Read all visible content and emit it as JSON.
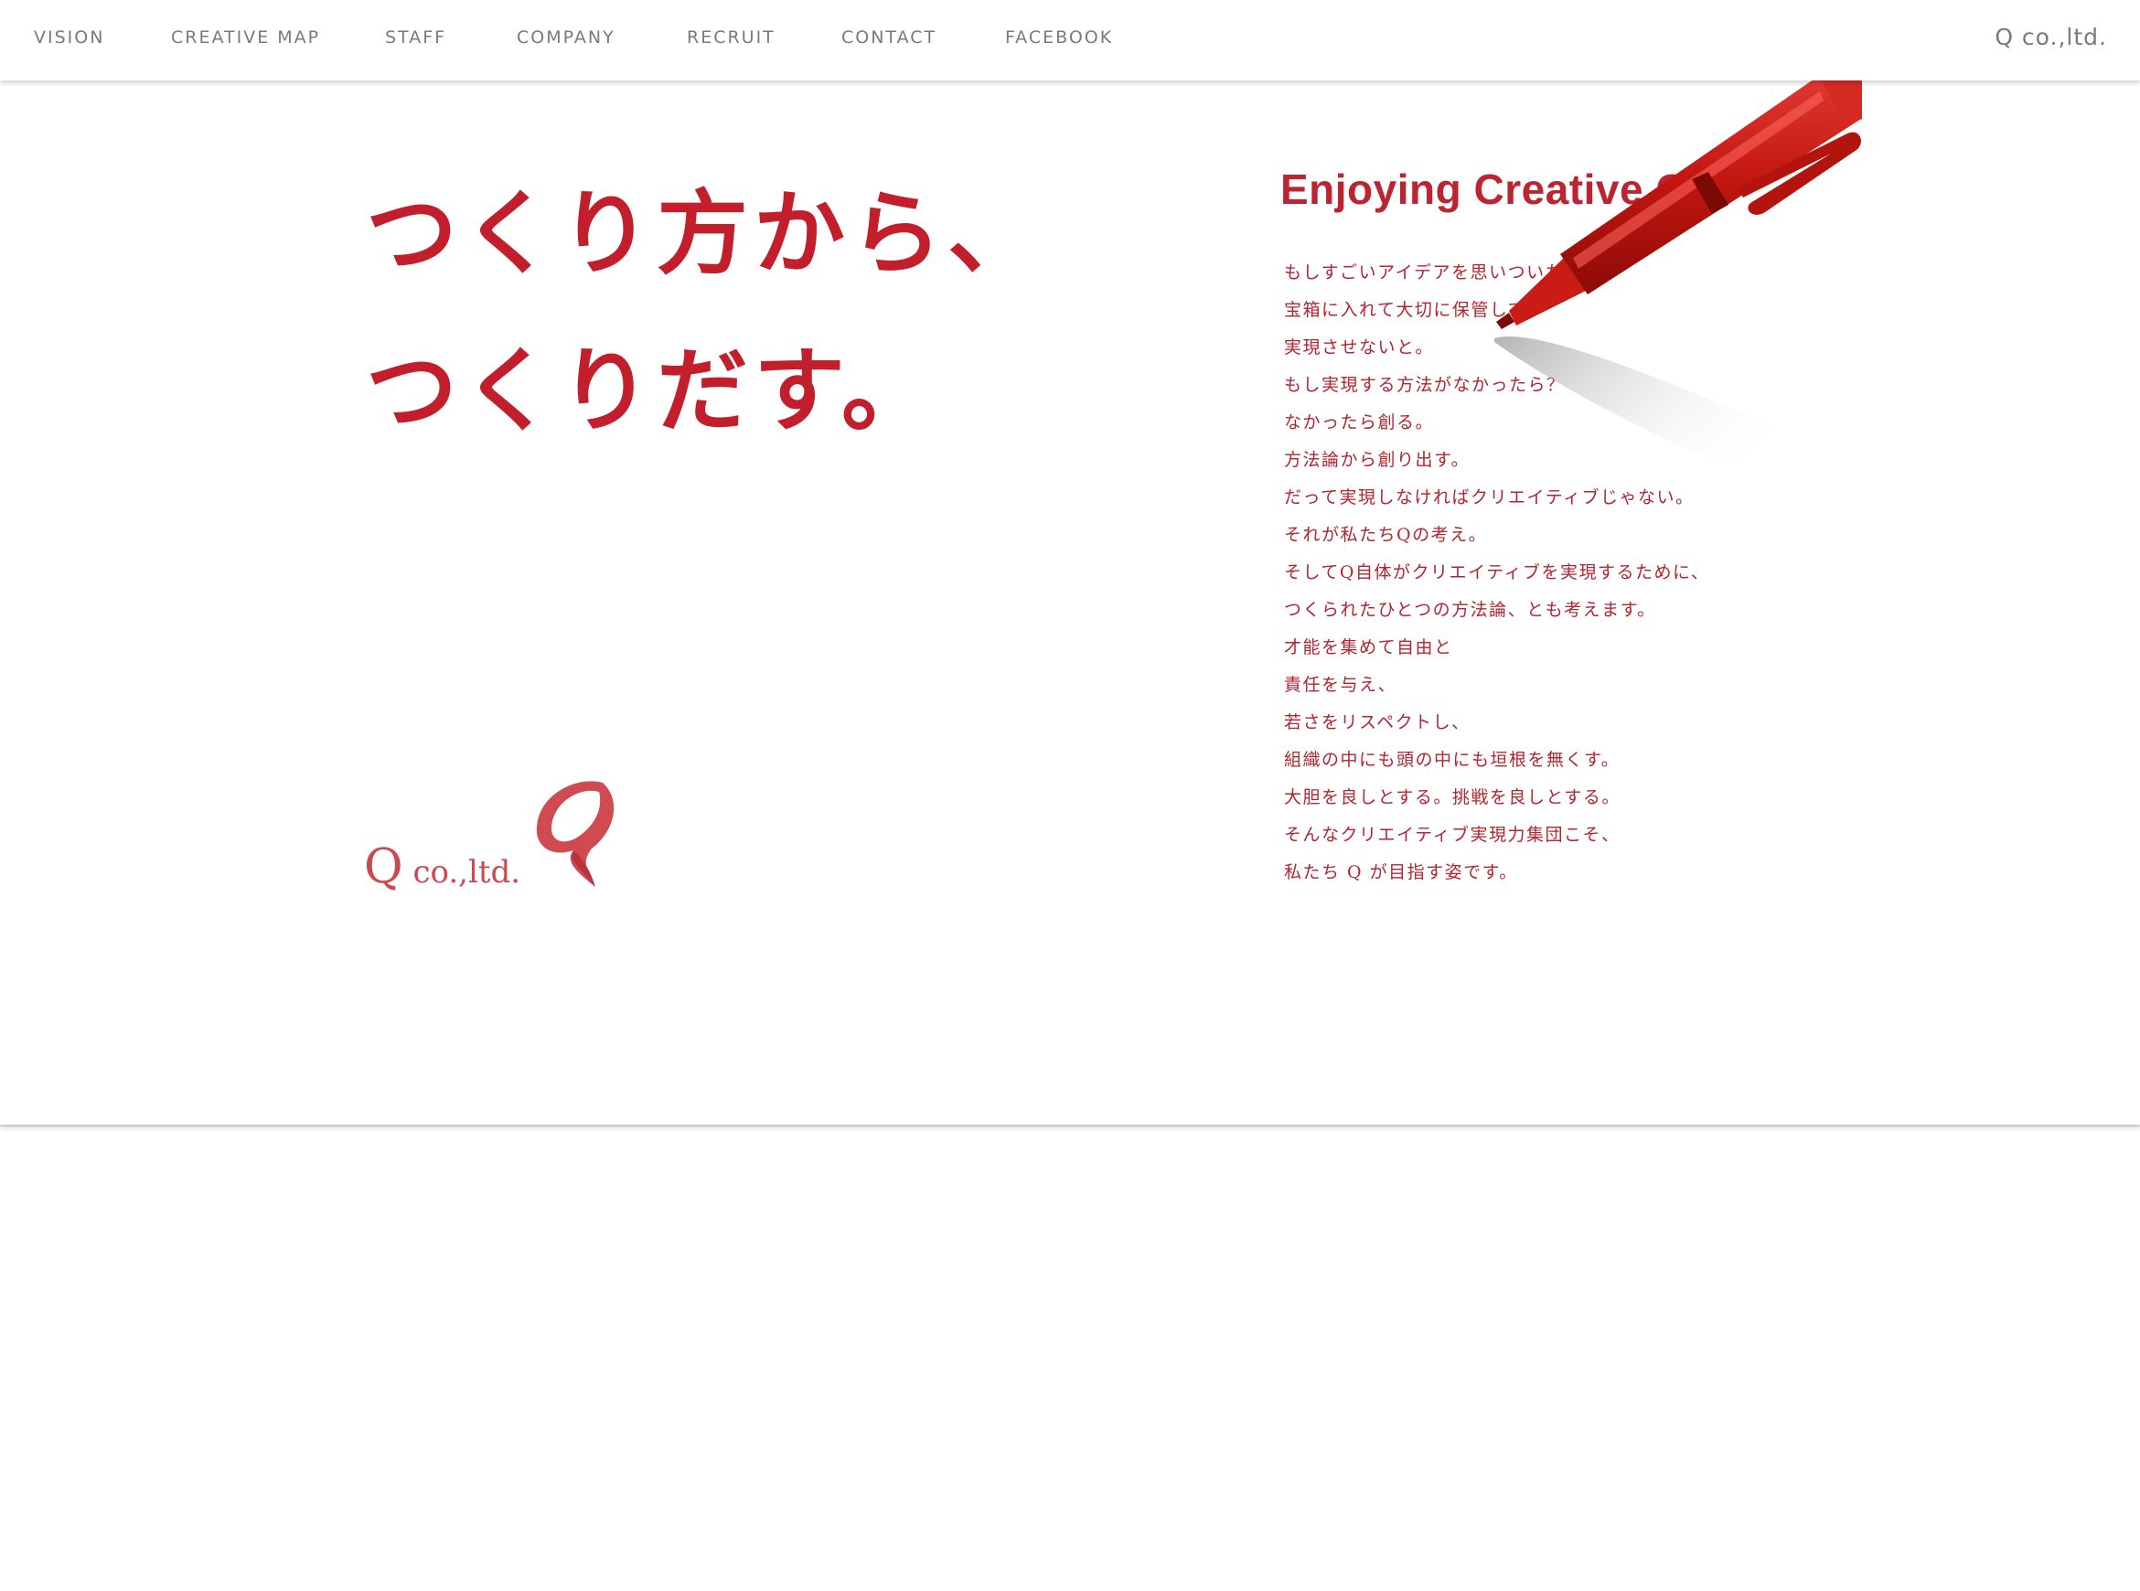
{
  "nav": {
    "items": [
      {
        "label": "VISION"
      },
      {
        "label": "CREATIVE MAP"
      },
      {
        "label": "STAFF"
      },
      {
        "label": "COMPANY"
      },
      {
        "label": "RECRUIT"
      },
      {
        "label": "CONTACT"
      },
      {
        "label": "FACEBOOK"
      }
    ],
    "brand": "Q co.,ltd."
  },
  "hero": {
    "headline": [
      "つくり方から、",
      "つくりだす。"
    ]
  },
  "logo": {
    "q": "Q",
    "rest": " co.,ltd."
  },
  "vision": {
    "subtitle": "Enjoying Creative Go",
    "lines": [
      "もしすごいアイデアを思いついた",
      "宝箱に入れて大切に保管して",
      "実現させないと。",
      "もし実現する方法がなかったら？",
      "なかったら創る。",
      "方法論から創り出す。",
      "だって実現しなければクリエイティブじゃない。",
      "それが私たちQの考え。",
      "そしてQ自体がクリエイティブを実現するために、",
      "つくられたひとつの方法論、とも考えます。",
      "才能を集めて自由と",
      "責任を与え、",
      "若さをリスペクトし、",
      "組織の中にも頭の中にも垣根を無くす。",
      "大胆を良しとする。挑戦を良しとする。",
      "そんなクリエイティブ実現力集団こそ、",
      "私たち Q が目指す姿です。"
    ]
  },
  "colors": {
    "accent": "#c21e2b",
    "nav_text": "#7a7a7a",
    "logo": "#cc4950"
  },
  "icons": {
    "pen": "red-pen-icon",
    "logo_mark": "q-logo-mark-icon"
  }
}
